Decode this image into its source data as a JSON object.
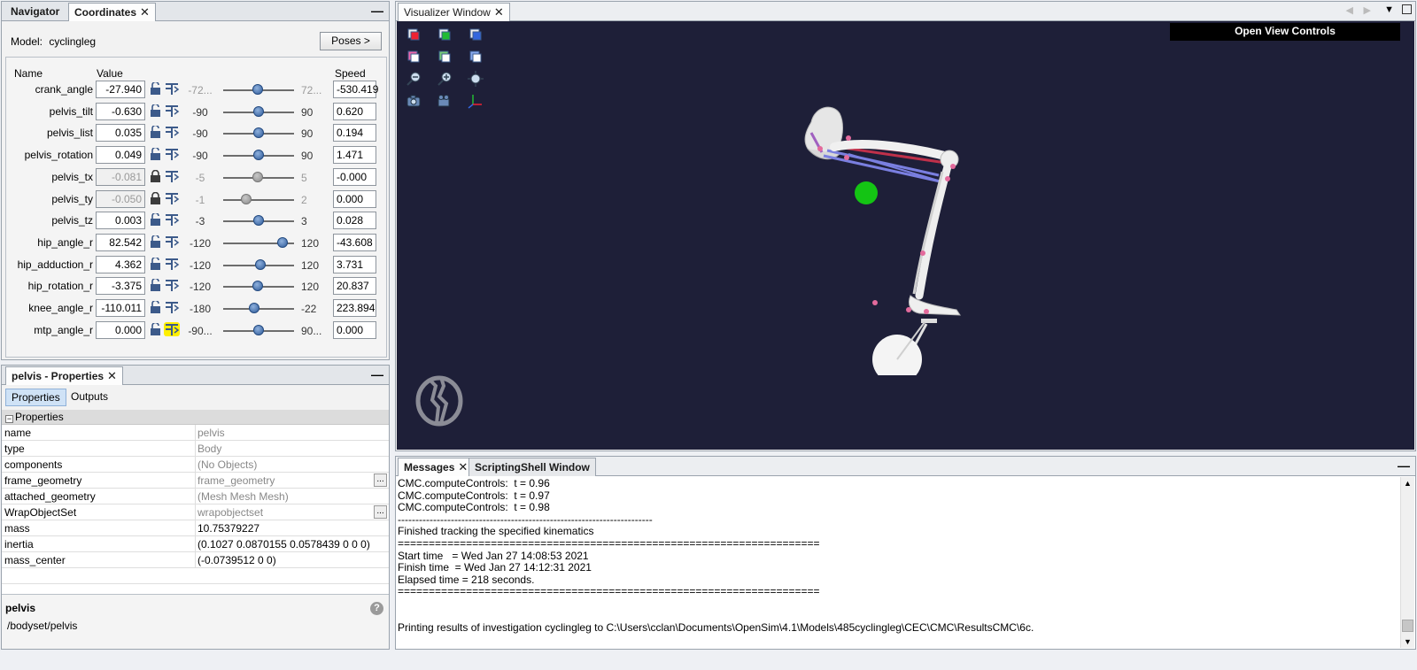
{
  "coordinates_panel": {
    "tabs": [
      "Navigator",
      "Coordinates"
    ],
    "model_label": "Model:",
    "model_name": "cyclingleg",
    "poses_label": "Poses >",
    "headers": {
      "name": "Name",
      "value": "Value",
      "speed": "Speed"
    },
    "rows": [
      {
        "name": "crank_angle",
        "value": "-27.940",
        "min": "-72...",
        "max": "72...",
        "speed": "-530.419",
        "locked": false,
        "fraction": 0.49,
        "min_dim": true
      },
      {
        "name": "pelvis_tilt",
        "value": "-0.630",
        "min": "-90",
        "max": "90",
        "speed": "0.620",
        "locked": false,
        "fraction": 0.5
      },
      {
        "name": "pelvis_list",
        "value": "0.035",
        "min": "-90",
        "max": "90",
        "speed": "0.194",
        "locked": false,
        "fraction": 0.5
      },
      {
        "name": "pelvis_rotation",
        "value": "0.049",
        "min": "-90",
        "max": "90",
        "speed": "1.471",
        "locked": false,
        "fraction": 0.5
      },
      {
        "name": "pelvis_tx",
        "value": "-0.081",
        "min": "-5",
        "max": "5",
        "speed": "-0.000",
        "locked": true,
        "fraction": 0.49
      },
      {
        "name": "pelvis_ty",
        "value": "-0.050",
        "min": "-1",
        "max": "2",
        "speed": "0.000",
        "locked": true,
        "fraction": 0.32
      },
      {
        "name": "pelvis_tz",
        "value": "0.003",
        "min": "-3",
        "max": "3",
        "speed": "0.028",
        "locked": false,
        "fraction": 0.5
      },
      {
        "name": "hip_angle_r",
        "value": "82.542",
        "min": "-120",
        "max": "120",
        "speed": "-43.608",
        "locked": false,
        "fraction": 0.84
      },
      {
        "name": "hip_adduction_r",
        "value": "4.362",
        "min": "-120",
        "max": "120",
        "speed": "3.731",
        "locked": false,
        "fraction": 0.52
      },
      {
        "name": "hip_rotation_r",
        "value": "-3.375",
        "min": "-120",
        "max": "120",
        "speed": "20.837",
        "locked": false,
        "fraction": 0.49
      },
      {
        "name": "knee_angle_r",
        "value": "-110.011",
        "min": "-180",
        "max": "-22",
        "speed": "223.894",
        "locked": false,
        "fraction": 0.44
      },
      {
        "name": "mtp_angle_r",
        "value": "0.000",
        "min": "-90...",
        "max": "90...",
        "speed": "0.000",
        "locked": false,
        "fraction": 0.5,
        "highlight": true
      }
    ]
  },
  "properties_panel": {
    "title": "pelvis - Properties",
    "subtabs": [
      "Properties",
      "Outputs"
    ],
    "group": "Properties",
    "rows": [
      {
        "key": "name",
        "value": "pelvis",
        "editable": false,
        "dots": false
      },
      {
        "key": "type",
        "value": "Body",
        "editable": false,
        "dots": false
      },
      {
        "key": "components",
        "value": "(No Objects)",
        "editable": false,
        "dots": false
      },
      {
        "key": "frame_geometry",
        "value": "frame_geometry",
        "editable": false,
        "dots": true
      },
      {
        "key": "attached_geometry",
        "value": "(Mesh Mesh Mesh)",
        "editable": false,
        "dots": false
      },
      {
        "key": "WrapObjectSet",
        "value": "wrapobjectset",
        "editable": false,
        "dots": true
      },
      {
        "key": "mass",
        "value": "10.75379227",
        "editable": true,
        "dots": false
      },
      {
        "key": "inertia",
        "value": "(0.1027 0.0870155 0.0578439 0 0 0)",
        "editable": true,
        "dots": false
      },
      {
        "key": "mass_center",
        "value": "(-0.0739512 0 0)",
        "editable": true,
        "dots": false
      }
    ],
    "footer_title": "pelvis",
    "footer_path": "/bodyset/pelvis"
  },
  "visualizer": {
    "tab": "Visualizer Window",
    "open_view_controls": "Open View Controls",
    "colors": {
      "background": "#1e1f38",
      "muscle_blue": "#7a7fe0",
      "muscle_red": "#c0304a",
      "marker_green": "#14c414"
    }
  },
  "messages_panel": {
    "tabs": [
      "Messages",
      "ScriptingShell Window"
    ],
    "lines": [
      "CMC.computeControls:  t = 0.96",
      "CMC.computeControls:  t = 0.97",
      "CMC.computeControls:  t = 0.98",
      "------------------------------------------------------------------------",
      "Finished tracking the specified kinematics",
      "====================================================================",
      "Start time   = Wed Jan 27 14:08:53 2021",
      "Finish time  = Wed Jan 27 14:12:31 2021",
      "Elapsed time = 218 seconds.",
      "====================================================================",
      "",
      "",
      "Printing results of investigation cyclingleg to C:\\Users\\cclan\\Documents\\OpenSim\\4.1\\Models\\485cyclingleg\\CEC\\CMC\\ResultsCMC\\6c."
    ]
  }
}
